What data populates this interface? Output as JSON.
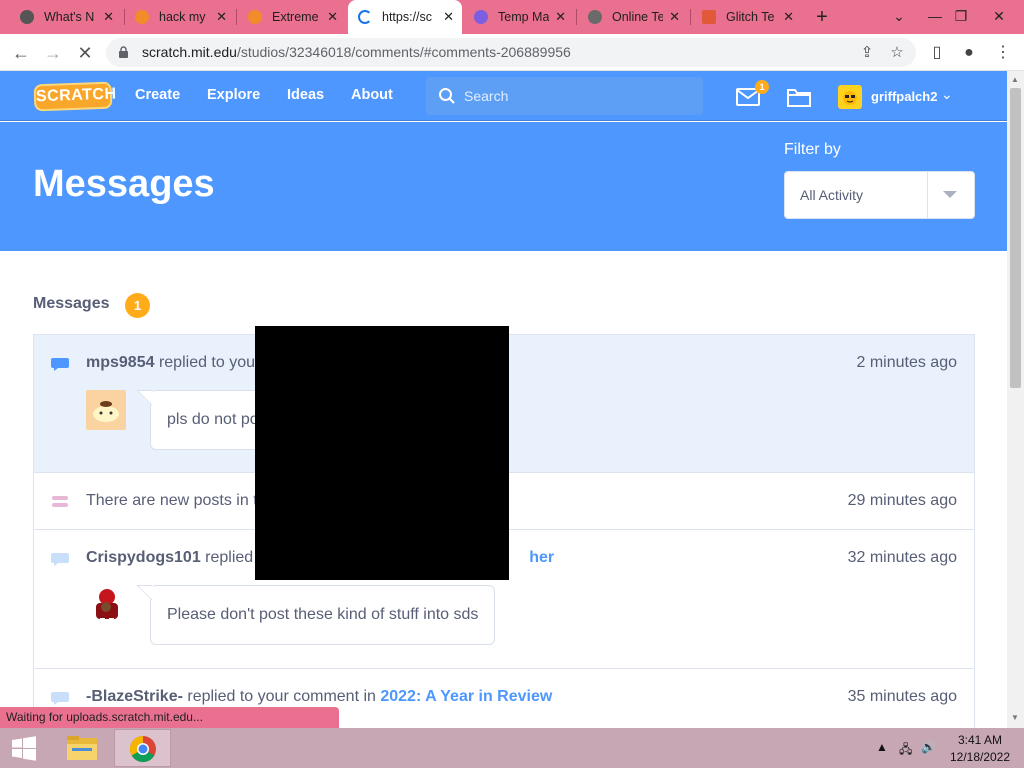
{
  "browser": {
    "tabs": [
      {
        "title": "What's N",
        "color": "#555"
      },
      {
        "title": "hack my",
        "color": "#f28c28"
      },
      {
        "title": "Extreme",
        "color": "#f28c28"
      },
      {
        "title": "https://sc",
        "color": "#1a73e8",
        "active": true
      },
      {
        "title": "Temp Ma",
        "color": "#7b5fe0"
      },
      {
        "title": "Online Te",
        "color": "#6a6a6a"
      },
      {
        "title": "Glitch Te",
        "color": "#e05a3a"
      }
    ],
    "new_tab_label": "+",
    "url_host": "scratch.mit.edu",
    "url_path": "/studios/32346018/comments/#comments-206889956",
    "status_text": "Waiting for uploads.scratch.mit.edu..."
  },
  "nav": {
    "logo_text": "SCRATCH",
    "links": [
      "Create",
      "Explore",
      "Ideas",
      "About"
    ],
    "search_placeholder": "Search",
    "mail_badge": "1",
    "username": "griffpalch2"
  },
  "banner": {
    "title": "Messages",
    "filter_label": "Filter by",
    "filter_value": "All Activity"
  },
  "messages": {
    "header": "Messages",
    "count": "1",
    "items": [
      {
        "user": "mps9854",
        "action": "replied to you",
        "link": "",
        "time": "2 minutes ago",
        "comment": "pls do not po",
        "unread": true
      },
      {
        "user": "",
        "action": "There are new posts in t",
        "link": "",
        "time": "29 minutes ago",
        "comment": ""
      },
      {
        "user": "Crispydogs101",
        "action": "replied",
        "link": "her",
        "time": "32 minutes ago",
        "comment": "Please don't post these kind of stuff into sds"
      },
      {
        "user": "-BlazeStrike-",
        "action": "replied to your comment in",
        "link": "2022: A Year in Review",
        "time": "35 minutes ago",
        "comment": ""
      }
    ]
  },
  "taskbar": {
    "time": "3:41 AM",
    "date": "12/18/2022"
  },
  "colors": {
    "scratch_blue": "#4d97ff",
    "tab_strip": "#e9708f",
    "badge_orange": "#ffab1a"
  }
}
